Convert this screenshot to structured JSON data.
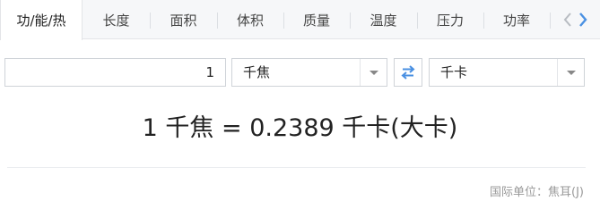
{
  "tabs": [
    {
      "label": "功/能/热",
      "active": true
    },
    {
      "label": "长度",
      "active": false
    },
    {
      "label": "面积",
      "active": false
    },
    {
      "label": "体积",
      "active": false
    },
    {
      "label": "质量",
      "active": false
    },
    {
      "label": "温度",
      "active": false
    },
    {
      "label": "压力",
      "active": false
    },
    {
      "label": "功率",
      "active": false
    }
  ],
  "converter": {
    "input_value": "1",
    "from_unit": "千焦",
    "to_unit": "千卡"
  },
  "result_text": "1 千焦 = 0.2389 千卡(大卡)",
  "footnote": "国际单位：焦耳(J)",
  "colors": {
    "accent": "#4a90e2",
    "tab_bar_bg": "#f6f7f9",
    "border": "#cfd3d8",
    "muted_text": "#999999"
  }
}
